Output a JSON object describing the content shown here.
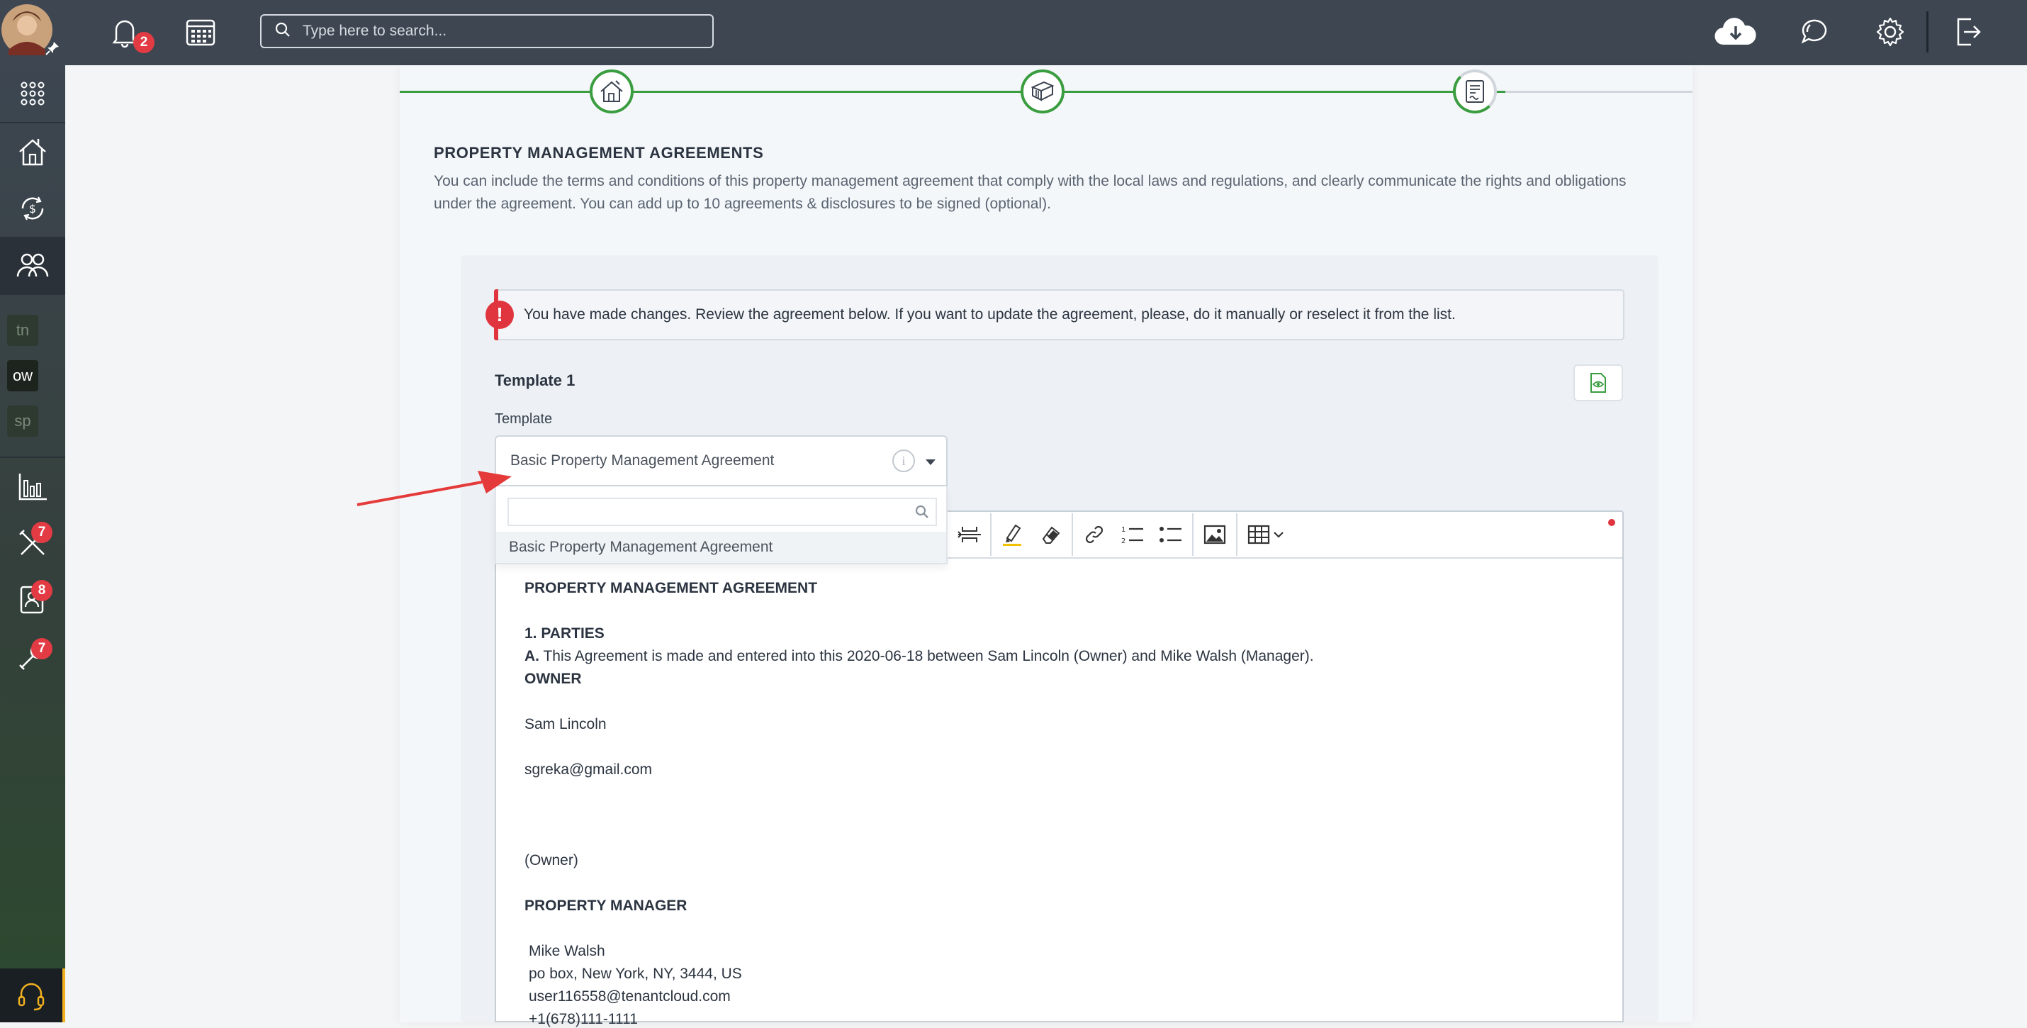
{
  "topbar": {
    "notifications_badge": "2",
    "search_placeholder": "Type here to search..."
  },
  "sidebar": {
    "tags": [
      "tn",
      "ow",
      "sp"
    ],
    "badges": {
      "tools": "7",
      "contacts": "8",
      "maintenance": "7"
    }
  },
  "main": {
    "section_title": "PROPERTY MANAGEMENT AGREEMENTS",
    "section_desc": "You can include the terms and conditions of this property management agreement that comply with the local laws and regulations, and clearly communicate the rights and obligations under the agreement. You can add up to 10 agreements & disclosures to be signed (optional).",
    "alert": "You have made changes. Review the agreement below. If you want to update the agreement, please, do it manually or reselect it from the list.",
    "template_heading": "Template 1",
    "template_label": "Template",
    "template_value": "Basic Property Management Agreement",
    "dropdown_option": "Basic Property Management Agreement"
  },
  "document": {
    "title": "PROPERTY MANAGEMENT AGREEMENT",
    "parties_heading": "1. PARTIES",
    "clause_a_label": "A.",
    "clause_a_text": " This Agreement is made and entered into this  2020-06-18 between Sam Lincoln  (Owner) and Mike Walsh  (Manager).",
    "owner_heading": "OWNER",
    "owner_name": "Sam Lincoln",
    "owner_email": "sgreka@gmail.com",
    "owner_role": "(Owner)",
    "manager_heading": "PROPERTY MANAGER",
    "manager_name": "Mike Walsh",
    "manager_address": "po box, New York, NY, 3444, US",
    "manager_email": "user116558@tenantcloud.com",
    "manager_phone": "+1(678)111-1111"
  },
  "colors": {
    "topbar": "#3d4651",
    "accent_green": "#3a9d3f",
    "alert_red": "#e0353f",
    "support_accent": "#f2b01e"
  }
}
